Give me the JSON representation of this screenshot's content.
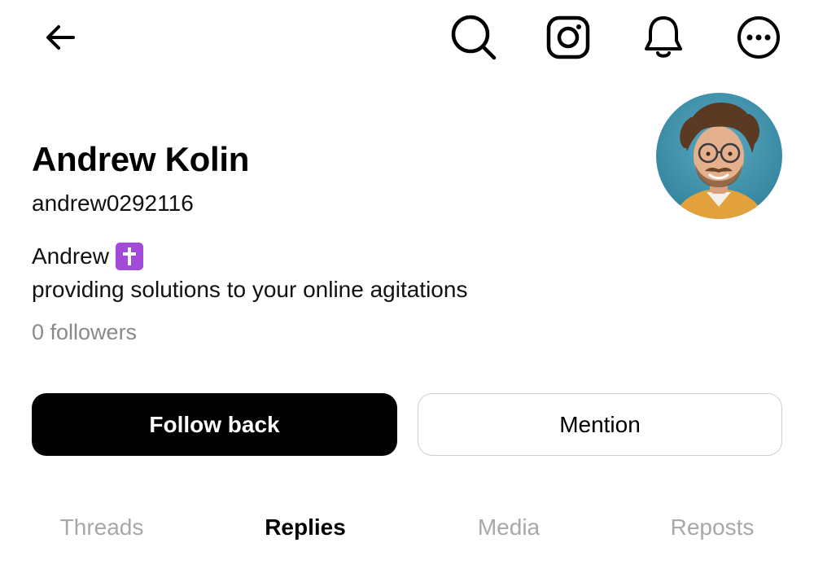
{
  "header": {
    "back_icon": "arrow-left-icon",
    "search_icon": "search-icon",
    "instagram_icon": "instagram-icon",
    "notifications_icon": "bell-icon",
    "more_icon": "more-horizontal-icon"
  },
  "profile": {
    "display_name": "Andrew Kolin",
    "username": "andrew0292116",
    "bio_name": "Andrew",
    "bio_emoji_icon": "latin-cross-icon",
    "bio_text": "providing solutions to your online agitations",
    "followers_text": "0 followers",
    "avatar_icon": "avatar-photo"
  },
  "actions": {
    "follow_label": "Follow back",
    "mention_label": "Mention"
  },
  "tabs": [
    {
      "label": "Threads",
      "active": false
    },
    {
      "label": "Replies",
      "active": true
    },
    {
      "label": "Media",
      "active": false
    },
    {
      "label": "Reposts",
      "active": false
    }
  ],
  "colors": {
    "accent_purple": "#a24bd8",
    "muted_text": "#8a8a8a",
    "inactive_tab": "#a8a8a8"
  }
}
